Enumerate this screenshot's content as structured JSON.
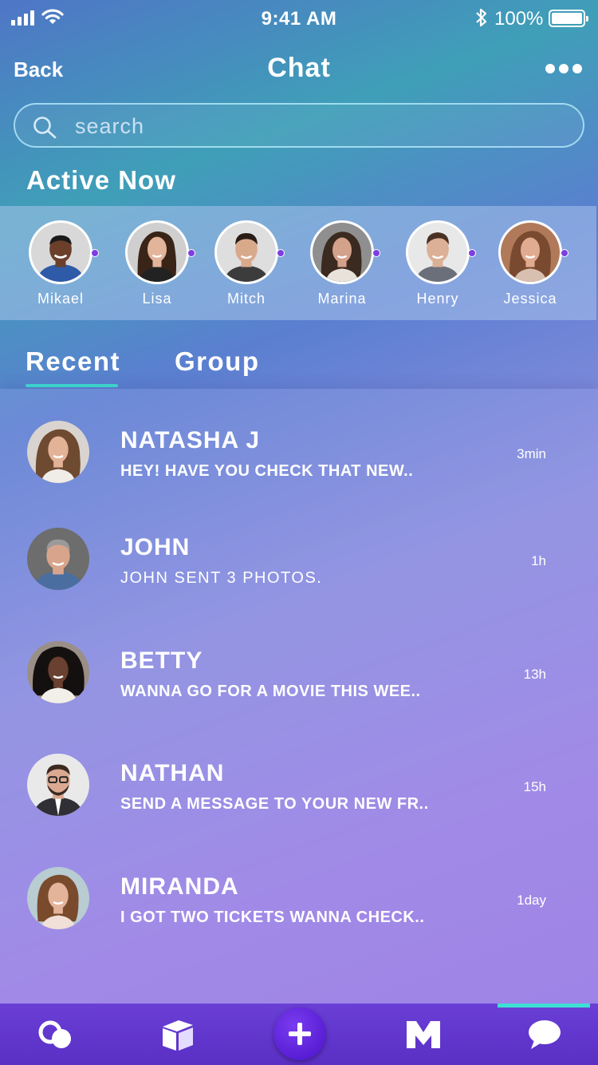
{
  "status_bar": {
    "time": "9:41 AM",
    "battery": "100%"
  },
  "header": {
    "back_label": "Back",
    "title": "Chat"
  },
  "search": {
    "placeholder": "search"
  },
  "active_now": {
    "title": "Active Now",
    "contacts": [
      {
        "name": "Mikael",
        "skin": "#6b3f2a",
        "hair": "#1a1a1a",
        "bg": "#d8d8d8"
      },
      {
        "name": "Lisa",
        "skin": "#e2b49a",
        "hair": "#3a2418",
        "bg": "#cfcfcf"
      },
      {
        "name": "Mitch",
        "skin": "#d9a98c",
        "hair": "#2a1d15",
        "bg": "#dedede"
      },
      {
        "name": "Marina",
        "skin": "#d4a18a",
        "hair": "#3b2a20",
        "bg": "#8f8f8f"
      },
      {
        "name": "Henry",
        "skin": "#dcb096",
        "hair": "#4a3222",
        "bg": "#e8e8e8"
      },
      {
        "name": "Jessica",
        "skin": "#e0ab90",
        "hair": "#7a4a30",
        "bg": "#b07a5a"
      }
    ]
  },
  "tabs": [
    {
      "label": "Recent"
    },
    {
      "label": "Group"
    }
  ],
  "conversations": [
    {
      "name": "NATASHA J",
      "message": "HEY! HAVE YOU CHECK THAT NEW..",
      "time": "3min",
      "skin": "#e3b398",
      "hair": "#6e4a30",
      "bg": "#d9d4cf"
    },
    {
      "name": "JOHN",
      "message": "JOHN SENT 3 PHOTOS.",
      "time": "1h",
      "skin": "#d8a58c",
      "hair": "#9a9a9a",
      "bg": "#6d6d6d"
    },
    {
      "name": "BETTY",
      "message": "WANNA GO FOR A MOVIE THIS WEE..",
      "time": "13h",
      "skin": "#6a4030",
      "hair": "#151010",
      "bg": "#9a8f86"
    },
    {
      "name": "NATHAN",
      "message": "SEND A MESSAGE TO YOUR NEW FR..",
      "time": "15h",
      "skin": "#dba992",
      "hair": "#3a2a20",
      "bg": "#e9e9e9"
    },
    {
      "name": "MIRANDA",
      "message": "I GOT TWO TICKETS WANNA CHECK..",
      "time": "1day",
      "skin": "#e4b49a",
      "hair": "#7a4a2c",
      "bg": "#b8ccd2"
    }
  ],
  "bottom_nav": [
    {
      "icon": "bubbles-icon"
    },
    {
      "icon": "box-icon"
    },
    {
      "icon": "plus-icon"
    },
    {
      "icon": "m-logo-icon",
      "glyph": "M"
    },
    {
      "icon": "chat-bubble-icon",
      "active": true
    }
  ],
  "colors": {
    "accent": "#3de0d2",
    "nav_bg": "#5a2fc4",
    "presence_dot": "#7d3fe0"
  }
}
